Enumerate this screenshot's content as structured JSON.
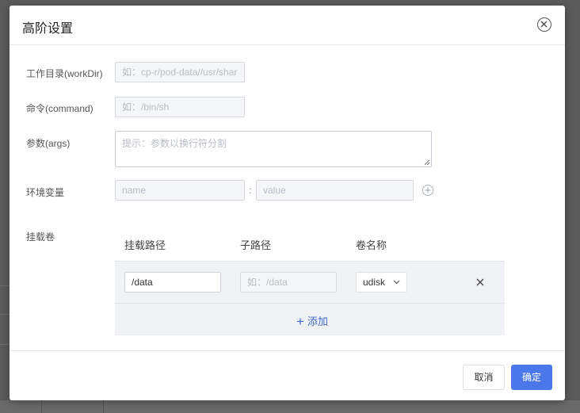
{
  "dialog": {
    "title": "高阶设置"
  },
  "form": {
    "workdir": {
      "label": "工作目录(workDir)",
      "placeholder": "如：cp-r/pod-data//usr/shar"
    },
    "command": {
      "label": "命令(command)",
      "placeholder": "如：/bin/sh"
    },
    "args": {
      "label": "参数(args)",
      "placeholder": "提示：参数以换行符分割"
    },
    "env": {
      "label": "环境变量",
      "name_placeholder": "name",
      "separator": ":",
      "value_placeholder": "value"
    },
    "volumes": {
      "label": "挂载卷",
      "columns": [
        "挂载路径",
        "子路径",
        "卷名称"
      ],
      "rows": [
        {
          "mount_path": "/data",
          "sub_path_placeholder": "如：/data",
          "volume_name": "udisk"
        }
      ],
      "add_label": "添加"
    }
  },
  "footer": {
    "cancel_label": "取消",
    "ok_label": "确定"
  },
  "colors": {
    "primary": "#4a78ea",
    "link": "#3d6ac6"
  },
  "icons": [
    "close-circle-icon",
    "plus-circle-icon",
    "chevron-down-icon",
    "close-icon",
    "plus-icon",
    "resize-grip-icon"
  ]
}
